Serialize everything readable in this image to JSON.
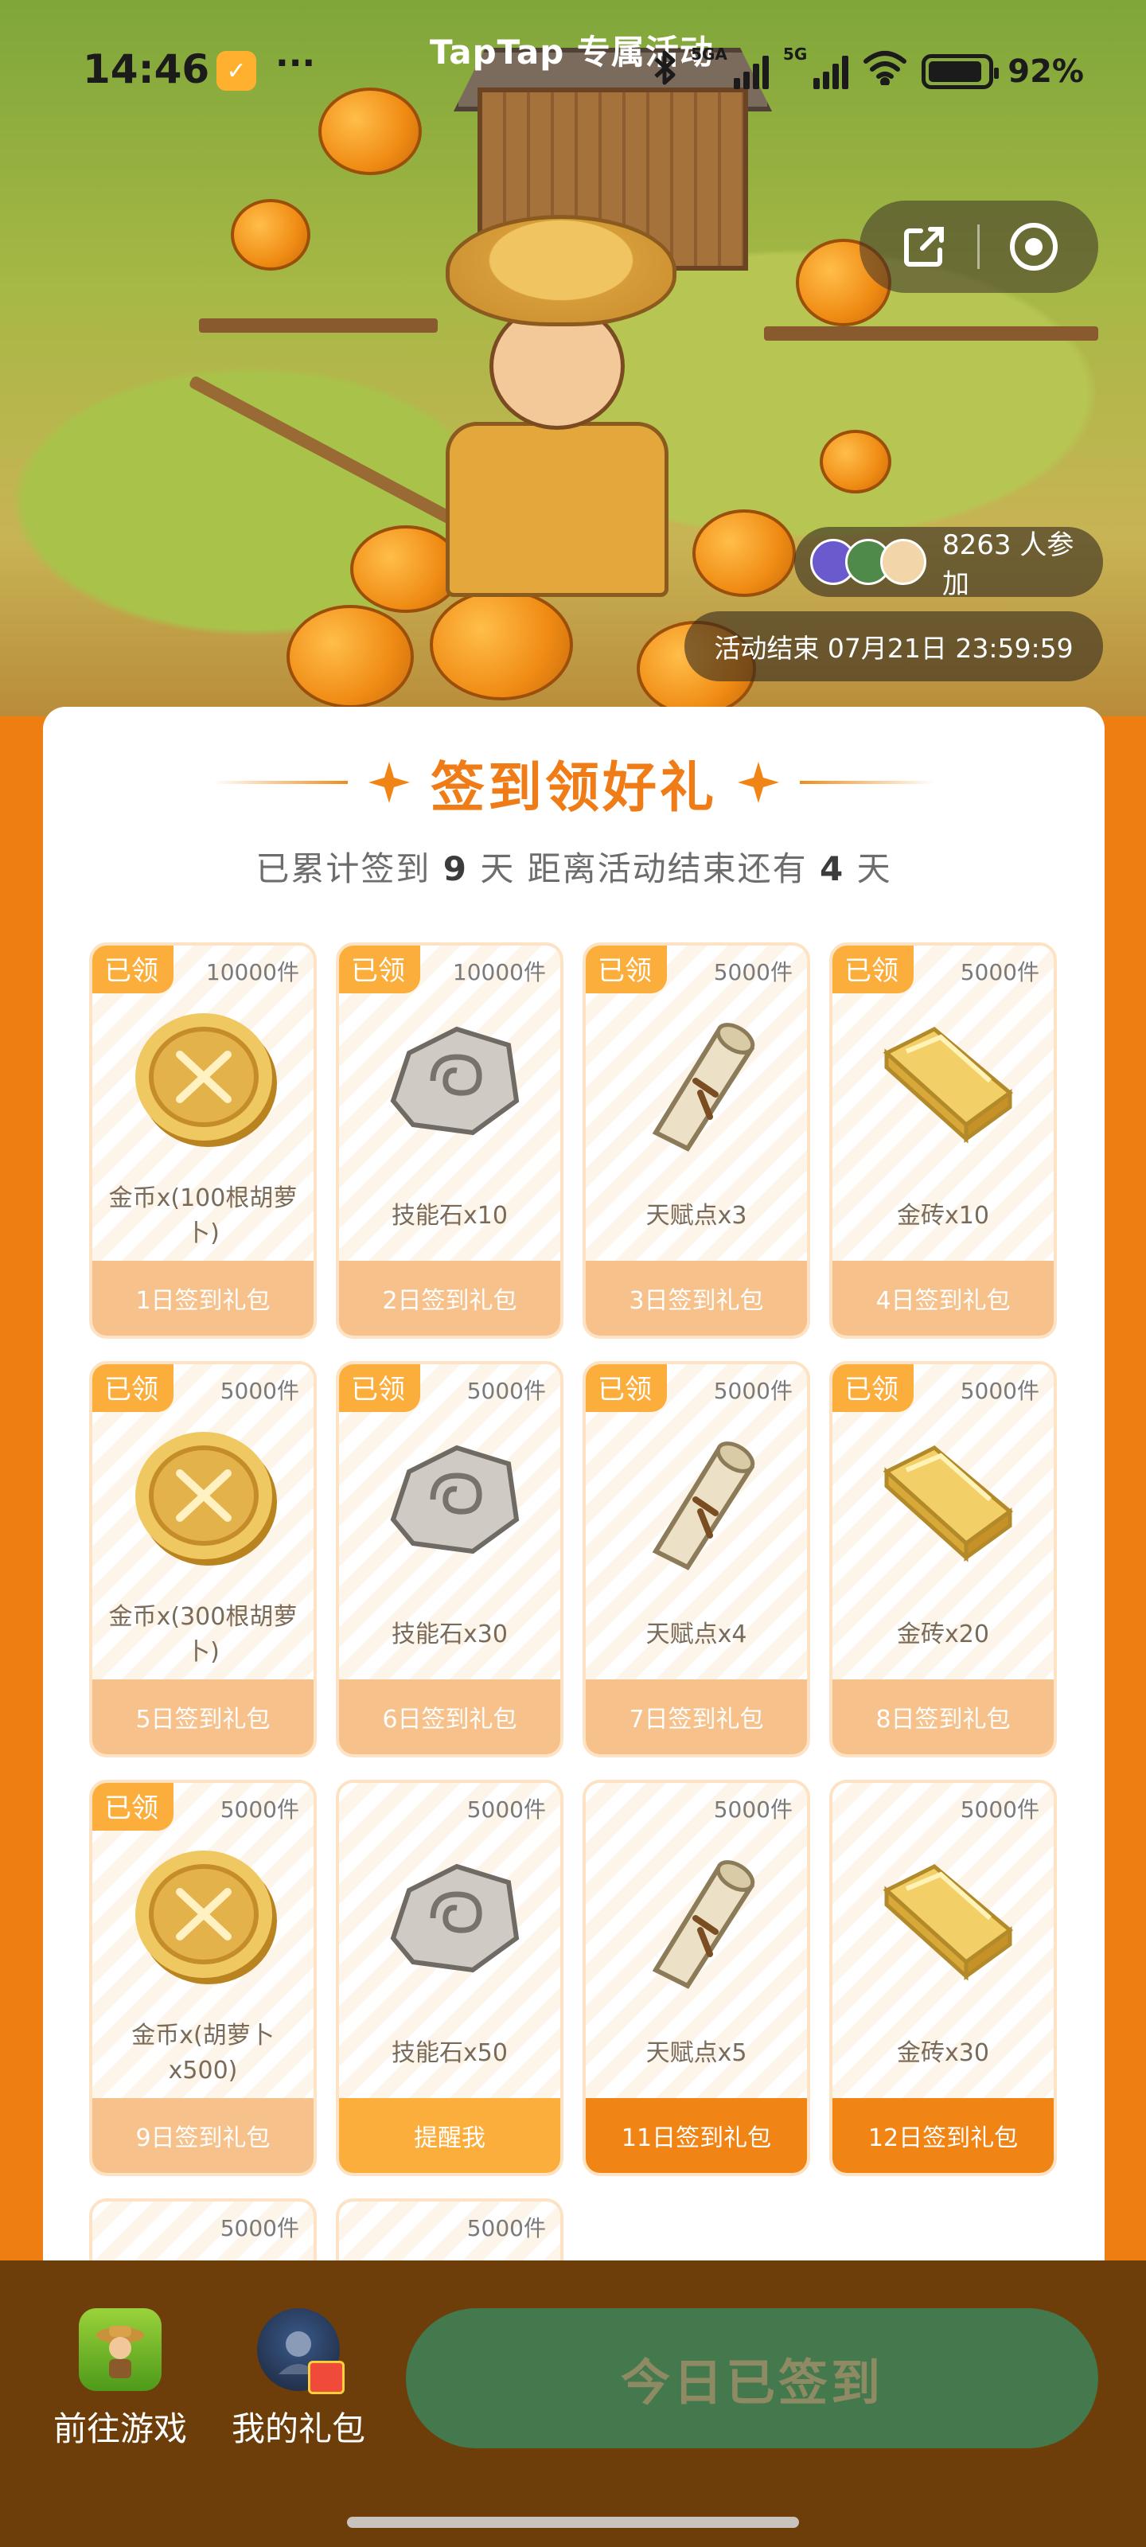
{
  "status_bar": {
    "time": "14:46",
    "app_title": "TapTap 专属活动",
    "network1": "5GA",
    "network2": "5G",
    "battery": "92%"
  },
  "hero": {
    "participants_count": "8263 人参加",
    "end_time": "活动结束 07月21日 23:59:59",
    "share_icon": "share-icon",
    "record_icon": "target-icon"
  },
  "card": {
    "title": "签到领好礼",
    "subtitle_prefix": "已累计签到 ",
    "subtitle_days": "9",
    "subtitle_mid": " 天  距离活动结束还有 ",
    "subtitle_remain": "4",
    "subtitle_suffix": " 天"
  },
  "gifts": [
    {
      "claimed": "已领",
      "qty": "10000件",
      "name": "金币x(100根胡萝卜)",
      "button": "1日签到礼包",
      "icon": "coin"
    },
    {
      "claimed": "已领",
      "qty": "10000件",
      "name": "技能石x10",
      "button": "2日签到礼包",
      "icon": "stone"
    },
    {
      "claimed": "已领",
      "qty": "5000件",
      "name": "天赋点x3",
      "button": "3日签到礼包",
      "icon": "scroll"
    },
    {
      "claimed": "已领",
      "qty": "5000件",
      "name": "金砖x10",
      "button": "4日签到礼包",
      "icon": "gold-bar"
    },
    {
      "claimed": "已领",
      "qty": "5000件",
      "name": "金币x(300根胡萝卜)",
      "button": "5日签到礼包",
      "icon": "coin"
    },
    {
      "claimed": "已领",
      "qty": "5000件",
      "name": "技能石x30",
      "button": "6日签到礼包",
      "icon": "stone"
    },
    {
      "claimed": "已领",
      "qty": "5000件",
      "name": "天赋点x4",
      "button": "7日签到礼包",
      "icon": "scroll"
    },
    {
      "claimed": "已领",
      "qty": "5000件",
      "name": "金砖x20",
      "button": "8日签到礼包",
      "icon": "gold-bar"
    },
    {
      "claimed": "已领",
      "qty": "5000件",
      "name": "金币x(胡萝卜x500)",
      "button": "9日签到礼包",
      "icon": "coin"
    },
    {
      "claimed": "",
      "qty": "5000件",
      "name": "技能石x50",
      "button": "提醒我",
      "icon": "stone"
    },
    {
      "claimed": "",
      "qty": "5000件",
      "name": "天赋点x5",
      "button": "11日签到礼包",
      "icon": "scroll"
    },
    {
      "claimed": "",
      "qty": "5000件",
      "name": "金砖x30",
      "button": "12日签到礼包",
      "icon": "gold-bar"
    },
    {
      "claimed": "",
      "qty": "5000件",
      "name": "",
      "button": "",
      "icon": ""
    },
    {
      "claimed": "",
      "qty": "5000件",
      "name": "",
      "button": "",
      "icon": ""
    }
  ],
  "bottom_bar": {
    "go_game": "前往游戏",
    "my_gifts": "我的礼包",
    "signed_button": "今日已签到"
  },
  "colors": {
    "brand_orange": "#ef7c17",
    "claimed_tag": "#fbae3c",
    "button_done": "#f7c18b",
    "button_active": "#f08414",
    "signed_button": "#43794c",
    "bottom_bar": "#6e3e0a"
  }
}
